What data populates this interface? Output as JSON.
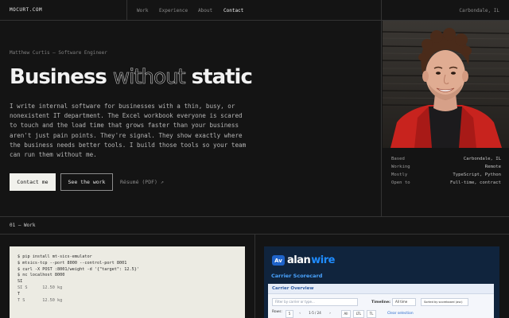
{
  "header": {
    "brand": "MOCURT.COM",
    "nav": [
      {
        "label": "Work"
      },
      {
        "label": "Experience"
      },
      {
        "label": "About"
      },
      {
        "label": "Contact"
      }
    ],
    "location": "Carbondale, IL"
  },
  "hero": {
    "eyebrow": "Matthew Curtis — Software Engineer",
    "headline_start": "Business ",
    "headline_outline": "without",
    "headline_end": " static",
    "intro": "I write internal software for businesses with a thin, busy, or nonexistent IT department. The Excel workbook everyone is scared to touch and the load time that grows faster than your business aren't just pain points. They're signal. They show exactly where the business needs better tools. I build those tools so your team can run them without me.",
    "buttons": {
      "contact": "Contact me",
      "work": "See the work",
      "resume": "Résumé (PDF) ↗"
    }
  },
  "facts": [
    {
      "label": "Based",
      "value": "Carbondale, IL"
    },
    {
      "label": "Working",
      "value": "Remote"
    },
    {
      "label": "Mostly",
      "value": "TypeScript, Python"
    },
    {
      "label": "Open to",
      "value": "Full-time, contract"
    }
  ],
  "work": {
    "section_label": "01 — Work",
    "terminal_lines": [
      "$ pip install mt-sics-emulator",
      "$ mtsics-tcp --port 8000 --control-port 8001",
      "$ curl -X POST :8001/weight -d '{\"target\": 12.5}'",
      "$ nc localhost 8000",
      "SI",
      "SI S      12.50 kg",
      "T",
      "T S       12.50 kg"
    ],
    "screenshot": {
      "logo_mark": "Av",
      "logo_alan": "alan",
      "logo_wire": "wire",
      "title": "Carrier Scorecard",
      "panel_title": "Carrier Overview",
      "filter_placeholder": "Filter by carrier or type...",
      "timeline_label": "Timeline:",
      "timeline_value": "All time",
      "sort_value": "Sorted by scoreboard (asc)",
      "rows_label": "Rows:",
      "rows_value": "5",
      "page_info": "1-5 / 24",
      "chips": [
        "All",
        "LTL",
        "TL"
      ],
      "clear_selection": "Clear selection"
    }
  },
  "colors": {
    "background": "#141414",
    "border": "#333333",
    "primary_button": "#f1f1ec",
    "brand_blue": "#1f8cff",
    "photo_shirt": "#c8231e"
  }
}
